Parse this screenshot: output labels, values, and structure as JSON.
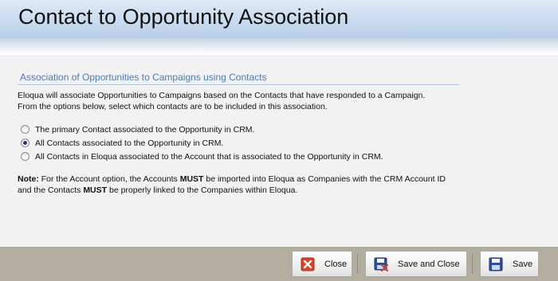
{
  "header": {
    "title": "Contact to Opportunity Association"
  },
  "section": {
    "title": "Association of Opportunities to Campaigns using Contacts",
    "description_line1": "Eloqua will associate Opportunities to Campaigns based on the Contacts that have responded to a Campaign.",
    "description_line2": "From the options below, select which contacts are to be included in this association."
  },
  "options": [
    {
      "label": "The primary Contact associated to the Opportunity in CRM.",
      "checked": false
    },
    {
      "label": "All Contacts associated to the Opportunity in CRM.",
      "checked": true
    },
    {
      "label": "All Contacts in Eloqua associated to the Account that is associated to the Opportunity in CRM.",
      "checked": false
    }
  ],
  "note": {
    "prefix": "Note:",
    "line1_a": " For the Account option, the Accounts ",
    "must": "MUST",
    "line1_b": " be imported into Eloqua as Companies with the CRM Account ID",
    "line2_a": "and the Contacts ",
    "line2_b": " be properly linked to the Companies within Eloqua."
  },
  "footer": {
    "close_label": "Close",
    "save_close_label": "Save and Close",
    "save_label": "Save"
  },
  "colors": {
    "section_title": "#4b7bb6",
    "close_icon": "#d9412b",
    "save_icon": "#2f4f9c"
  },
  "icons": {
    "close": "close-icon",
    "save_close": "save-and-close-icon",
    "save": "floppy-disk-icon"
  }
}
